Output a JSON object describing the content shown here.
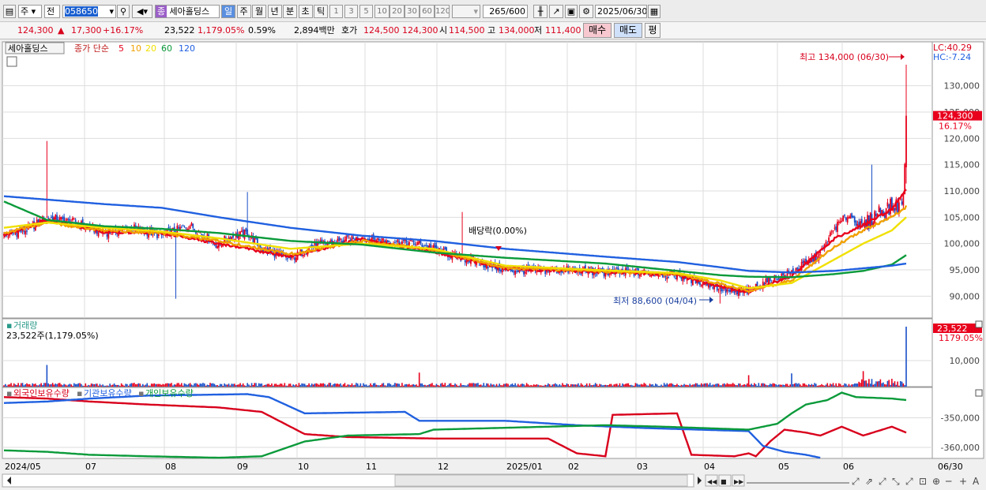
{
  "toolbar": {
    "market": "주",
    "type": "전",
    "code": "058650",
    "name_tag": "종",
    "stock_name": "세아홀딩스",
    "periods": [
      "일",
      "주",
      "월",
      "년",
      "분",
      "초",
      "틱"
    ],
    "active_period": "일",
    "intervals": [
      "1",
      "3",
      "5",
      "10",
      "20",
      "30",
      "60",
      "120"
    ],
    "count": "265",
    "count_max": "/600",
    "date": "2025/06/30"
  },
  "quote": {
    "price": "124,300",
    "arrow": "▲",
    "change": "17,300",
    "change_pct": "+16.17%",
    "volume": "23,522",
    "volume_pct": "1,179.05%",
    "turnover": "0.59%",
    "amount": "2,894백만",
    "ask_label": "호가",
    "ask": "124,500",
    "bid": "124,300",
    "open_label": "시",
    "open": "114,500",
    "high_label": "고",
    "high": "134,000",
    "low_label": "저",
    "low": "111,400",
    "buy_btn": "매수",
    "sell_btn": "매도",
    "eval_btn": "평"
  },
  "price_panel": {
    "stock_label": "세아홀딩스",
    "ma_label": "종가 단순",
    "ma_periods": [
      {
        "label": "5",
        "color": "#e8001c"
      },
      {
        "label": "10",
        "color": "#f0a000"
      },
      {
        "label": "20",
        "color": "#f0e000"
      },
      {
        "label": "60",
        "color": "#0a9a3a"
      },
      {
        "label": "120",
        "color": "#2060e0"
      }
    ],
    "lc": "LC:40.29",
    "hc": "HC:-7.24",
    "high_note": "최고 134,000 (06/30)",
    "low_note": "최저 88,600 (04/04)",
    "dividend_note": "배당락(0.00%)",
    "current_tag": "124,300",
    "current_pct": "16.17%",
    "y_ticks": [
      "130,000",
      "125,000",
      "120,000",
      "115,000",
      "110,000",
      "105,000",
      "100,000",
      "95,000",
      "90,000"
    ]
  },
  "volume_panel": {
    "title": "거래량",
    "value": "23,522주(1,179.05%)",
    "current_tag": "23,522",
    "current_pct": "1179.05%",
    "y_ticks": [
      "10,000"
    ]
  },
  "holdings_panel": {
    "legends": [
      {
        "label": "외국인보유수량",
        "color": "#d8001c"
      },
      {
        "label": "기관보유수량",
        "color": "#2060e0"
      },
      {
        "label": "개인보유수량",
        "color": "#0a9a3a"
      }
    ],
    "y_ticks": [
      "-350,000",
      "-360,000"
    ]
  },
  "x_axis": [
    "2024/05",
    "07",
    "08",
    "09",
    "10",
    "11",
    "12",
    "2025/01",
    "02",
    "03",
    "04",
    "05",
    "06",
    "06/30"
  ],
  "chart_data": {
    "type": "candlestick",
    "x_labels": [
      "2024/05",
      "07",
      "08",
      "09",
      "10",
      "11",
      "12",
      "2025/01",
      "02",
      "03",
      "04",
      "05",
      "06",
      "06/30"
    ],
    "ylim": [
      86000,
      137000
    ],
    "price_anchors": [
      [
        0,
        101500
      ],
      [
        15,
        102500
      ],
      [
        30,
        105000
      ],
      [
        50,
        104000
      ],
      [
        70,
        102000
      ],
      [
        90,
        103000
      ],
      [
        110,
        101500
      ],
      [
        130,
        103500
      ],
      [
        150,
        99500
      ],
      [
        155,
        101000
      ],
      [
        170,
        102000
      ],
      [
        180,
        99000
      ],
      [
        200,
        97000
      ],
      [
        215,
        99500
      ],
      [
        235,
        100500
      ],
      [
        250,
        101000
      ],
      [
        270,
        100500
      ],
      [
        290,
        100000
      ],
      [
        310,
        98000
      ],
      [
        330,
        96500
      ],
      [
        350,
        95000
      ],
      [
        370,
        94800
      ],
      [
        390,
        95000
      ],
      [
        420,
        94500
      ],
      [
        450,
        94500
      ],
      [
        470,
        94000
      ],
      [
        490,
        92500
      ],
      [
        510,
        90500
      ],
      [
        520,
        91000
      ],
      [
        530,
        92500
      ],
      [
        550,
        94500
      ],
      [
        570,
        98000
      ],
      [
        580,
        103000
      ],
      [
        590,
        105500
      ],
      [
        600,
        103000
      ],
      [
        610,
        106000
      ],
      [
        620,
        107000
      ],
      [
        627,
        107500
      ],
      [
        629,
        114000
      ],
      [
        630,
        124300
      ]
    ],
    "ma_series": [
      {
        "name": "5",
        "anchors": [
          [
            0,
            101500
          ],
          [
            30,
            104500
          ],
          [
            70,
            102200
          ],
          [
            110,
            102000
          ],
          [
            150,
            100000
          ],
          [
            200,
            97500
          ],
          [
            250,
            100800
          ],
          [
            300,
            98500
          ],
          [
            350,
            95200
          ],
          [
            420,
            94600
          ],
          [
            470,
            94100
          ],
          [
            500,
            91800
          ],
          [
            520,
            90800
          ],
          [
            550,
            93800
          ],
          [
            580,
            101000
          ],
          [
            600,
            103500
          ],
          [
            620,
            106500
          ],
          [
            630,
            110500
          ]
        ]
      },
      {
        "name": "10",
        "anchors": [
          [
            0,
            102000
          ],
          [
            30,
            104000
          ],
          [
            70,
            102500
          ],
          [
            110,
            102000
          ],
          [
            150,
            100500
          ],
          [
            200,
            98000
          ],
          [
            250,
            100500
          ],
          [
            300,
            98800
          ],
          [
            350,
            95400
          ],
          [
            420,
            94700
          ],
          [
            470,
            94200
          ],
          [
            500,
            92300
          ],
          [
            520,
            91000
          ],
          [
            550,
            93000
          ],
          [
            580,
            99500
          ],
          [
            600,
            102500
          ],
          [
            620,
            105000
          ],
          [
            630,
            107000
          ]
        ]
      },
      {
        "name": "20",
        "anchors": [
          [
            0,
            103000
          ],
          [
            30,
            104000
          ],
          [
            70,
            103000
          ],
          [
            110,
            102300
          ],
          [
            150,
            101000
          ],
          [
            200,
            99000
          ],
          [
            250,
            100000
          ],
          [
            300,
            99000
          ],
          [
            350,
            95800
          ],
          [
            420,
            94900
          ],
          [
            470,
            94400
          ],
          [
            500,
            93000
          ],
          [
            520,
            91500
          ],
          [
            550,
            92500
          ],
          [
            580,
            97000
          ],
          [
            600,
            100000
          ],
          [
            620,
            102500
          ],
          [
            630,
            105000
          ]
        ]
      },
      {
        "name": "60",
        "anchors": [
          [
            0,
            108000
          ],
          [
            30,
            104500
          ],
          [
            70,
            103300
          ],
          [
            110,
            102800
          ],
          [
            150,
            102000
          ],
          [
            200,
            100500
          ],
          [
            250,
            99800
          ],
          [
            300,
            98300
          ],
          [
            350,
            97300
          ],
          [
            420,
            96200
          ],
          [
            470,
            94800
          ],
          [
            500,
            94000
          ],
          [
            520,
            93700
          ],
          [
            550,
            93600
          ],
          [
            580,
            94200
          ],
          [
            600,
            94800
          ],
          [
            620,
            96000
          ],
          [
            630,
            97800
          ]
        ]
      },
      {
        "name": "120",
        "anchors": [
          [
            0,
            109000
          ],
          [
            70,
            107500
          ],
          [
            110,
            106800
          ],
          [
            150,
            105000
          ],
          [
            200,
            103000
          ],
          [
            250,
            101500
          ],
          [
            300,
            100500
          ],
          [
            350,
            99000
          ],
          [
            420,
            97500
          ],
          [
            470,
            96500
          ],
          [
            500,
            95500
          ],
          [
            520,
            94800
          ],
          [
            550,
            94500
          ],
          [
            580,
            94800
          ],
          [
            600,
            95300
          ],
          [
            620,
            95800
          ],
          [
            630,
            96200
          ]
        ]
      }
    ],
    "holdings": [
      {
        "name": "외국인보유수량",
        "anchors": [
          [
            0,
            -343000
          ],
          [
            30,
            -343500
          ],
          [
            60,
            -344500
          ],
          [
            100,
            -345500
          ],
          [
            150,
            -346500
          ],
          [
            180,
            -348000
          ],
          [
            210,
            -355500
          ],
          [
            240,
            -356500
          ],
          [
            300,
            -357000
          ],
          [
            380,
            -357000
          ],
          [
            400,
            -362000
          ],
          [
            420,
            -363000
          ],
          [
            425,
            -349000
          ],
          [
            470,
            -348500
          ],
          [
            480,
            -362500
          ],
          [
            510,
            -363000
          ],
          [
            520,
            -362000
          ],
          [
            525,
            -363000
          ],
          [
            535,
            -358000
          ],
          [
            545,
            -354000
          ],
          [
            560,
            -355000
          ],
          [
            570,
            -356000
          ],
          [
            585,
            -353000
          ],
          [
            600,
            -356000
          ],
          [
            620,
            -353000
          ],
          [
            630,
            -355000
          ]
        ]
      },
      {
        "name": "기관보유수량",
        "anchors": [
          [
            0,
            -345000
          ],
          [
            30,
            -344500
          ],
          [
            60,
            -343500
          ],
          [
            100,
            -342500
          ],
          [
            170,
            -342000
          ],
          [
            185,
            -343000
          ],
          [
            210,
            -348500
          ],
          [
            280,
            -348000
          ],
          [
            290,
            -351000
          ],
          [
            350,
            -351000
          ],
          [
            400,
            -352500
          ],
          [
            450,
            -353500
          ],
          [
            520,
            -354500
          ],
          [
            530,
            -359500
          ],
          [
            545,
            -361500
          ],
          [
            560,
            -362500
          ],
          [
            570,
            -363500
          ]
        ]
      },
      {
        "name": "개인보유수량",
        "anchors": [
          [
            0,
            -361000
          ],
          [
            30,
            -361500
          ],
          [
            60,
            -362500
          ],
          [
            100,
            -363000
          ],
          [
            150,
            -363500
          ],
          [
            180,
            -363000
          ],
          [
            210,
            -358000
          ],
          [
            240,
            -356000
          ],
          [
            290,
            -355500
          ],
          [
            300,
            -354000
          ],
          [
            380,
            -353000
          ],
          [
            420,
            -352500
          ],
          [
            460,
            -353000
          ],
          [
            520,
            -354000
          ],
          [
            540,
            -352000
          ],
          [
            550,
            -348500
          ],
          [
            560,
            -345500
          ],
          [
            575,
            -344000
          ],
          [
            585,
            -341500
          ],
          [
            595,
            -343000
          ],
          [
            620,
            -343500
          ],
          [
            630,
            -344000
          ]
        ]
      }
    ],
    "holdings_ylim": [
      -364000,
      -340000
    ],
    "volume_ylim": [
      0,
      23522
    ],
    "volume_highlights": [
      [
        30,
        8500
      ],
      [
        290,
        5500
      ],
      [
        520,
        4500
      ],
      [
        550,
        5200
      ],
      [
        600,
        4500
      ],
      [
        630,
        23522
      ]
    ],
    "total_points": 631
  }
}
